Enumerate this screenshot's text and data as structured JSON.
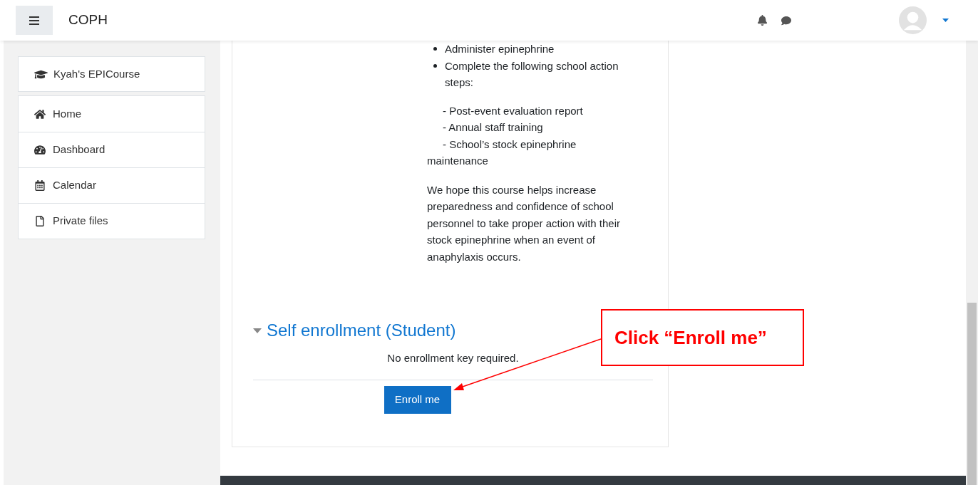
{
  "header": {
    "site_name": "COPH"
  },
  "sidebar": {
    "course": {
      "label": "Kyah's EPICourse"
    },
    "items": [
      {
        "label": "Home"
      },
      {
        "label": "Dashboard"
      },
      {
        "label": "Calendar"
      },
      {
        "label": "Private files"
      }
    ]
  },
  "content": {
    "bullets": [
      "Administer epinephrine",
      "Complete the following school action steps:"
    ],
    "steps": [
      "- Post-event evaluation report",
      "- Annual staff training",
      "- School’s stock epinephrine maintenance"
    ],
    "paragraph": "We hope this course helps increase preparedness and confidence of school personnel to take proper action with their stock epinephrine when an event of anaphylaxis occurs."
  },
  "enrollment": {
    "title": "Self enrollment (Student)",
    "expanded": true,
    "note": "No enrollment key required.",
    "button": "Enroll me"
  },
  "annotation": {
    "text": "Click “Enroll me”"
  }
}
